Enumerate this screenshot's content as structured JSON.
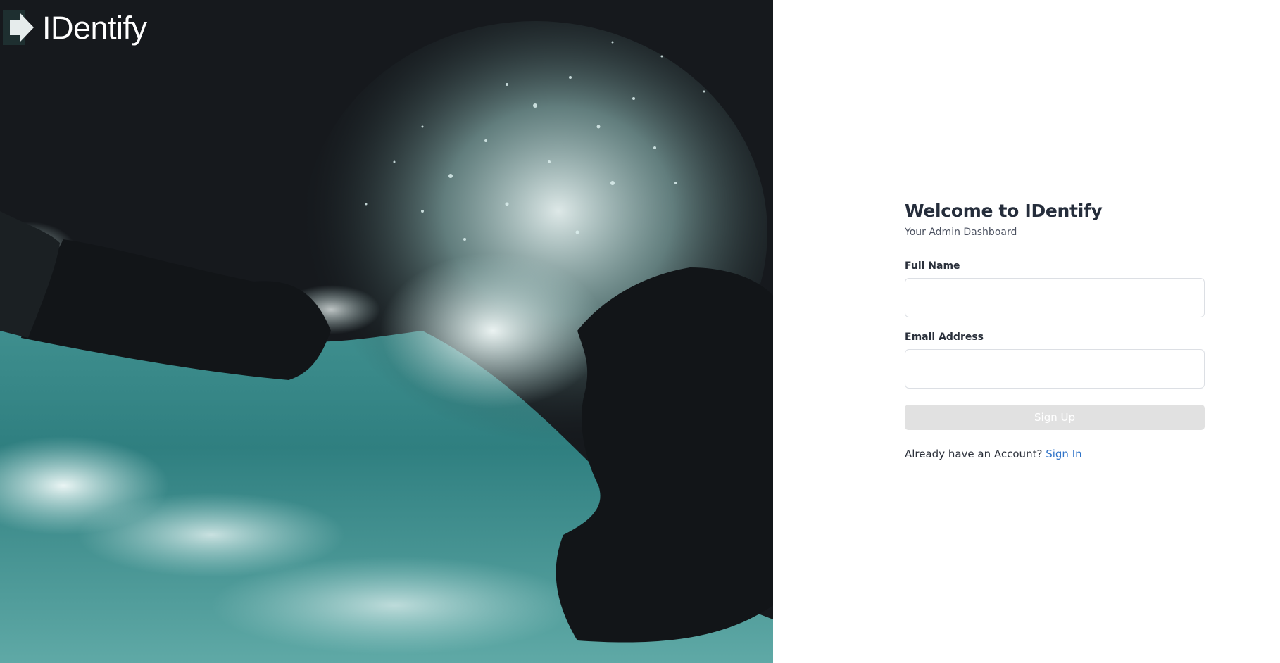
{
  "brand": {
    "name": "IDentify",
    "icon": "arrow-right-icon"
  },
  "hero": {
    "image": "ocean-waves-crashing-on-dark-rocks"
  },
  "form": {
    "title": "Welcome to IDentify",
    "subtitle": "Your Admin Dashboard",
    "full_name": {
      "label": "Full Name",
      "value": "",
      "placeholder": ""
    },
    "email": {
      "label": "Email Address",
      "value": "",
      "placeholder": ""
    },
    "submit_label": "Sign Up",
    "signin_prompt": "Already have an Account?",
    "signin_link": "Sign In"
  },
  "colors": {
    "accent_link": "#2f73c8",
    "button_disabled": "#e1e1e1",
    "heading": "#252d3b",
    "hero_dark": "#16191d",
    "water_teal": "#3f8f8f"
  }
}
